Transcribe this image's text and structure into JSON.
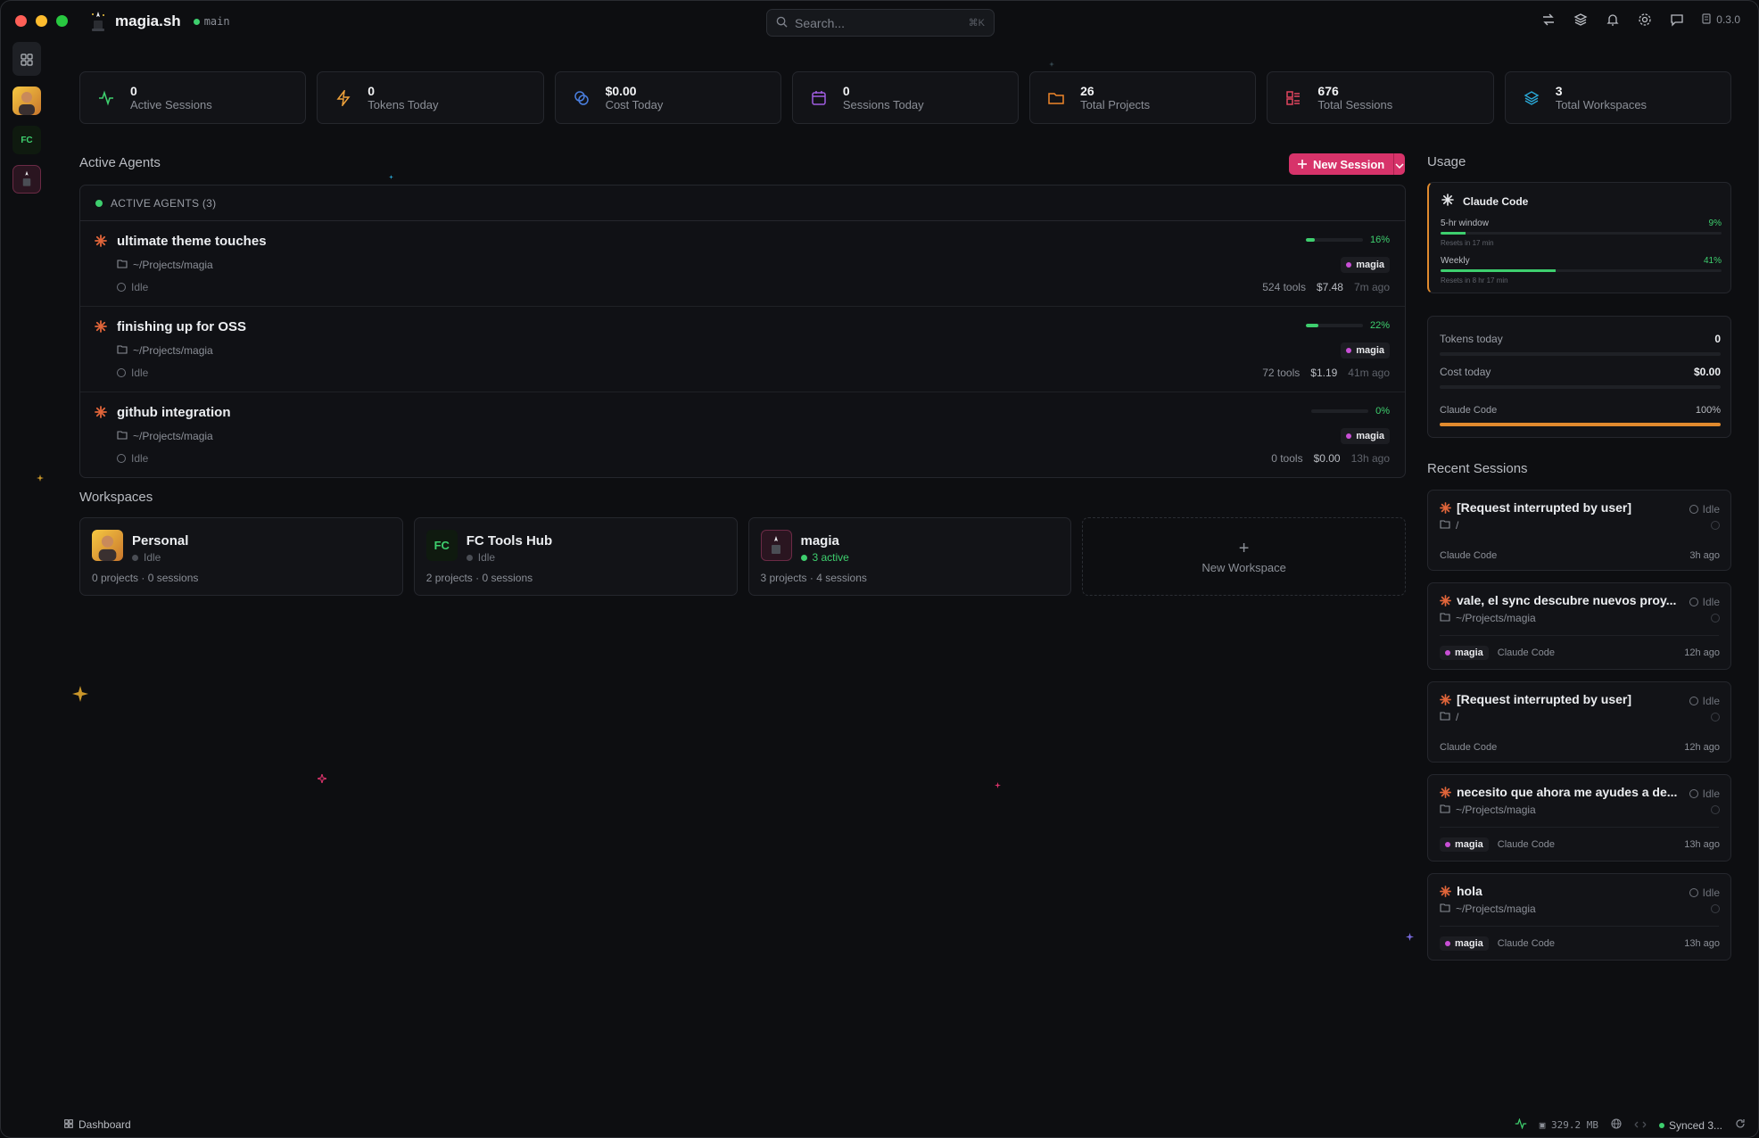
{
  "app": {
    "name": "magia.sh",
    "branch": "main",
    "version": "0.3.0"
  },
  "search": {
    "placeholder": "Search...",
    "shortcut": "⌘K"
  },
  "stats": [
    {
      "value": "0",
      "label": "Active Sessions",
      "icon": "activity-icon",
      "color": "#3ecf6e"
    },
    {
      "value": "0",
      "label": "Tokens Today",
      "icon": "lightning-icon",
      "color": "#f0a23a"
    },
    {
      "value": "$0.00",
      "label": "Cost Today",
      "icon": "coins-icon",
      "color": "#4a7fe0"
    },
    {
      "value": "0",
      "label": "Sessions Today",
      "icon": "calendar-icon",
      "color": "#a05de0"
    },
    {
      "value": "26",
      "label": "Total Projects",
      "icon": "folder-icon",
      "color": "#f0862a"
    },
    {
      "value": "676",
      "label": "Total Sessions",
      "icon": "grid-icon",
      "color": "#e0455e"
    },
    {
      "value": "3",
      "label": "Total Workspaces",
      "icon": "layers-icon",
      "color": "#2aa9d8"
    }
  ],
  "active_agents": {
    "section_title": "Active Agents",
    "new_session_label": "New Session",
    "header_label": "ACTIVE AGENTS (3)",
    "items": [
      {
        "title": "ultimate theme touches",
        "path": "~/Projects/magia",
        "status": "Idle",
        "progress": 16,
        "progress_label": "16%",
        "tag": "magia",
        "tools": "524 tools",
        "cost": "$7.48",
        "ago": "7m ago"
      },
      {
        "title": "finishing up for OSS",
        "path": "~/Projects/magia",
        "status": "Idle",
        "progress": 22,
        "progress_label": "22%",
        "tag": "magia",
        "tools": "72 tools",
        "cost": "$1.19",
        "ago": "41m ago"
      },
      {
        "title": "github integration",
        "path": "~/Projects/magia",
        "status": "Idle",
        "progress": 0,
        "progress_label": "0%",
        "tag": "magia",
        "tools": "0 tools",
        "cost": "$0.00",
        "ago": "13h ago"
      }
    ]
  },
  "workspaces": {
    "section_title": "Workspaces",
    "items": [
      {
        "name": "Personal",
        "state": "Idle",
        "stats": "0 projects · 0 sessions"
      },
      {
        "name": "FC Tools Hub",
        "state": "Idle",
        "stats": "2 projects · 0 sessions",
        "avatar_text": "FC"
      },
      {
        "name": "magia",
        "state": "3 active",
        "stats": "3 projects · 4 sessions"
      }
    ],
    "new_label": "New Workspace"
  },
  "usage": {
    "section_title": "Usage",
    "provider": "Claude Code",
    "window": {
      "label": "5-hr window",
      "pct": 9,
      "pct_label": "9%",
      "reset": "Resets in 17 min"
    },
    "weekly": {
      "label": "Weekly",
      "pct": 41,
      "pct_label": "41%",
      "reset": "Resets in 8 hr 17 min"
    },
    "tokens_today_label": "Tokens today",
    "tokens_today": "0",
    "cost_today_label": "Cost today",
    "cost_today": "$0.00",
    "provider_share_label": "Claude Code",
    "provider_share": 100,
    "provider_share_text": "100%"
  },
  "recent_sessions": {
    "section_title": "Recent Sessions",
    "items": [
      {
        "title": "[Request interrupted by user]",
        "status": "Idle",
        "path": "/",
        "tag": "",
        "provider": "Claude Code",
        "ago": "3h ago"
      },
      {
        "title": "vale, el sync descubre nuevos proy...",
        "status": "Idle",
        "path": "~/Projects/magia",
        "tag": "magia",
        "provider": "Claude Code",
        "ago": "12h ago"
      },
      {
        "title": "[Request interrupted by user]",
        "status": "Idle",
        "path": "/",
        "tag": "",
        "provider": "Claude Code",
        "ago": "12h ago"
      },
      {
        "title": "necesito que ahora me ayudes a de...",
        "status": "Idle",
        "path": "~/Projects/magia",
        "tag": "magia",
        "provider": "Claude Code",
        "ago": "13h ago"
      },
      {
        "title": "hola",
        "status": "Idle",
        "path": "~/Projects/magia",
        "tag": "magia",
        "provider": "Claude Code",
        "ago": "13h ago"
      }
    ]
  },
  "statusbar": {
    "page": "Dashboard",
    "memory": "329.2 MB",
    "sync": "Synced 3..."
  }
}
